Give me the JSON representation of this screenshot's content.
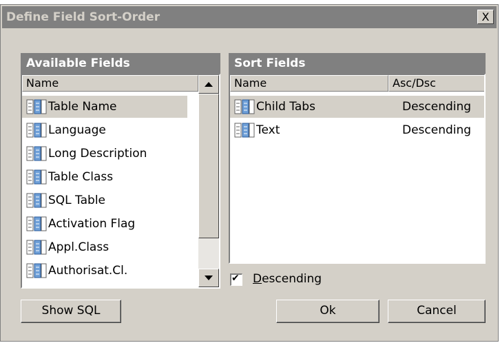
{
  "window": {
    "title": "Define Field Sort-Order",
    "close_glyph": "X"
  },
  "available": {
    "header": "Available Fields",
    "column": "Name",
    "items": [
      {
        "label": "Table Name",
        "icon": "field-icon",
        "selected": true
      },
      {
        "label": "Language",
        "icon": "field-icon"
      },
      {
        "label": "Long Description",
        "icon": "field-icon"
      },
      {
        "label": "Table Class",
        "icon": "field-icon"
      },
      {
        "label": "SQL Table",
        "icon": "field-icon"
      },
      {
        "label": "Activation Flag",
        "icon": "field-icon"
      },
      {
        "label": "Appl.Class",
        "icon": "field-icon"
      },
      {
        "label": "Authorisat.Cl.",
        "icon": "field-icon"
      }
    ]
  },
  "sort": {
    "header": "Sort Fields",
    "columns": [
      "Name",
      "Asc/Dsc"
    ],
    "items": [
      {
        "name": "Child Tabs",
        "order": "Descending",
        "icon": "field-icon",
        "selected": true
      },
      {
        "name": "Text",
        "order": "Descending",
        "icon": "field-icon"
      }
    ]
  },
  "descending_checkbox": {
    "label_underlined": "D",
    "label_rest": "escending",
    "checked": true,
    "check_glyph": "✔"
  },
  "buttons": {
    "show_sql": "Show SQL",
    "ok": "Ok",
    "cancel": "Cancel"
  }
}
